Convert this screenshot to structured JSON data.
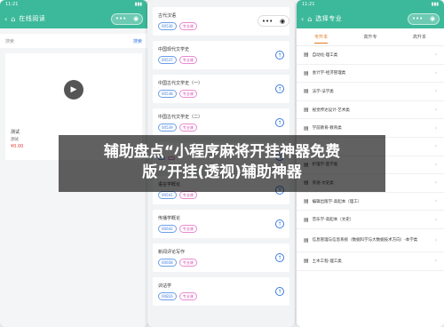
{
  "phone1": {
    "time": "11:21",
    "title": "在线阅读",
    "search_placeholder": "搜索",
    "search_link": "搜索",
    "video": {
      "title": "测试",
      "sub": "测试",
      "price": "¥0.00"
    }
  },
  "phone2": {
    "courses": [
      {
        "title": "古代汉语",
        "tags": [
          "00536",
          "专业课"
        ]
      },
      {
        "title": "中国现代文学史",
        "tags": [
          "00537",
          "专业课"
        ]
      },
      {
        "title": "中国古代文学史（一）",
        "tags": [
          "00538",
          "专业课"
        ]
      },
      {
        "title": "中国古代文学史（二）",
        "tags": [
          "00539",
          "专业课"
        ]
      },
      {
        "title": "",
        "tags": [
          "",
          ""
        ]
      },
      {
        "title": "语言学概论",
        "tags": [
          "00541",
          "专业课"
        ]
      },
      {
        "title": "传播学概论",
        "tags": [
          "00642",
          "专业课"
        ]
      },
      {
        "title": "新闻评论写作",
        "tags": [
          "00658",
          "专业课"
        ]
      },
      {
        "title": "训诂学",
        "tags": [
          "00816",
          "专业课"
        ]
      }
    ]
  },
  "phone3": {
    "time": "11:21",
    "title": "选择专业",
    "tabs": [
      "专升本",
      "高升专",
      "高升本"
    ],
    "majors": [
      "自动化-理工类",
      "会计学-经济管理类",
      "法学-法学类",
      "视觉传达设计-艺术类",
      "学前教育-教育类",
      "",
      "护理学-医学类",
      "英语-文史类",
      "编辑出版学-高起本（理工）",
      "音乐学-高起本（文史）",
      "信息管理与信息系统（数据科学与大数据技术方向）-本学类",
      "土木工程-理工类"
    ]
  },
  "banner": {
    "line1": "辅助盘点“小程序麻将开挂神器免费",
    "line2": "版”开挂(透视)辅助神器"
  }
}
